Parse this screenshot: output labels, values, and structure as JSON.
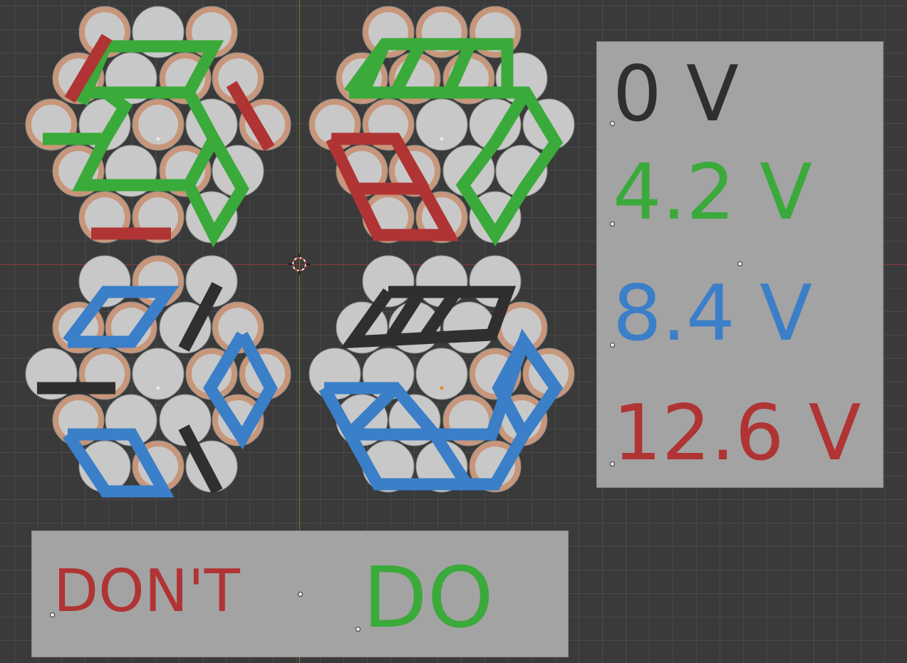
{
  "viewport": {
    "x_axis_color": "#8a3a3a",
    "y_axis_color": "#6a8a2a",
    "grid_color": "#4a4a4a",
    "background_color": "#3a3a3a"
  },
  "colors": {
    "cell_wrap_copper": "#c8967a",
    "cell_wrap_gray": "#c8c8c8",
    "ground": "#2f2f2f",
    "green": "#3aaa3a",
    "blue": "#3a7fc8",
    "red": "#b03434"
  },
  "legend": {
    "v0": "0 V",
    "v1": "4.2 V",
    "v2": "8.4 V",
    "v3": "12.6 V"
  },
  "labels": {
    "dont": "DON'T",
    "do": "DO"
  },
  "icons": {
    "cursor": "3d-cursor-icon"
  }
}
